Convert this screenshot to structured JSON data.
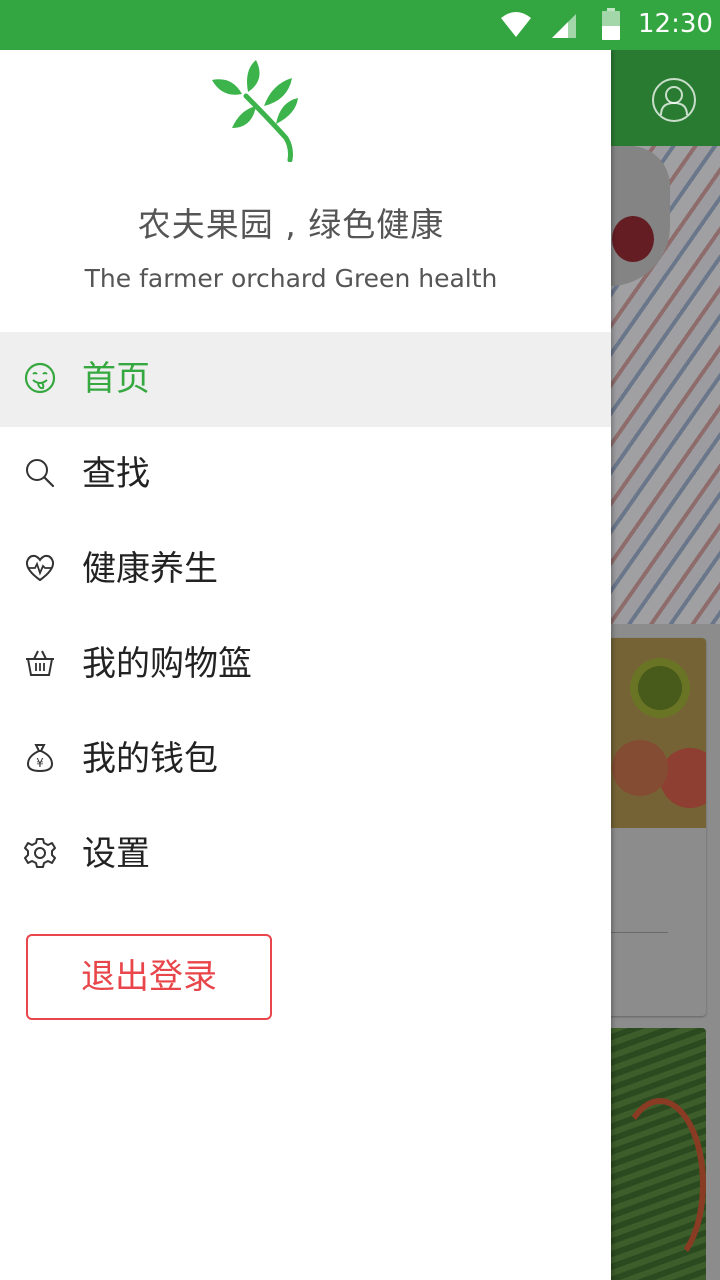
{
  "status_bar": {
    "time": "12:30",
    "color": "#34a641"
  },
  "header": {
    "slogan_cn": "农夫果园 , 绿色健康",
    "slogan_en": "The farmer orchard Green health",
    "logo": "leaf-branch-logo"
  },
  "menu": {
    "items": [
      {
        "label": "首页",
        "icon": "smile-icon",
        "active": true
      },
      {
        "label": "查找",
        "icon": "search-icon",
        "active": false
      },
      {
        "label": "健康养生",
        "icon": "heart-pulse-icon",
        "active": false
      },
      {
        "label": "我的购物篮",
        "icon": "basket-icon",
        "active": false
      },
      {
        "label": "我的钱包",
        "icon": "money-bag-icon",
        "active": false
      },
      {
        "label": "设置",
        "icon": "gear-icon",
        "active": false
      }
    ]
  },
  "logout_label": "退出登录",
  "colors": {
    "accent": "#35a83f",
    "logout": "#e8464a",
    "appbar": "#2a7b32"
  }
}
